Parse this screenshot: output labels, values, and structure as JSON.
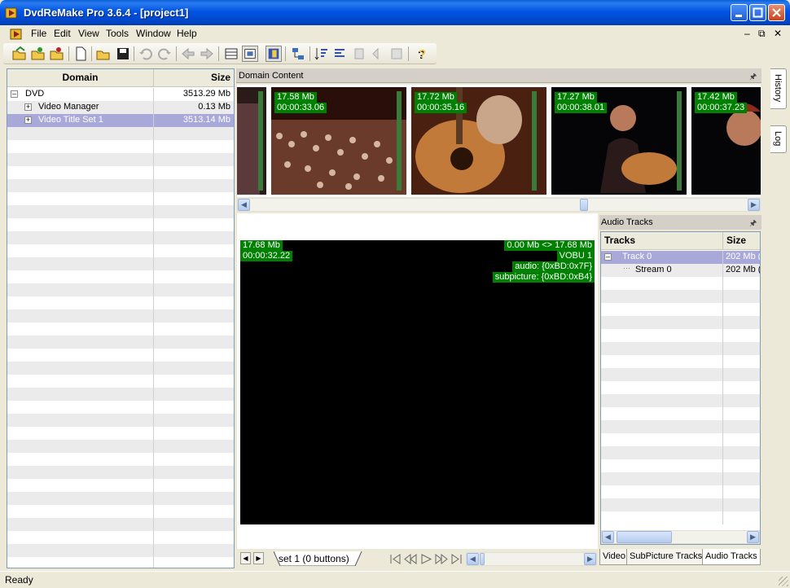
{
  "window": {
    "title": "DvdReMake Pro 3.6.4 - [project1]"
  },
  "menu": {
    "items": [
      "File",
      "Edit",
      "View",
      "Tools",
      "Window",
      "Help"
    ]
  },
  "tree": {
    "columns": [
      "Domain",
      "Size"
    ],
    "rows": [
      {
        "label": "DVD",
        "size": "3513.29 Mb"
      },
      {
        "label": "Video Manager",
        "size": "0.13 Mb"
      },
      {
        "label": "Video Title Set 1",
        "size": "3513.14 Mb"
      }
    ]
  },
  "domain_content": {
    "title": "Domain Content",
    "thumbnails": [
      {
        "size": "",
        "time": ""
      },
      {
        "size": "17.58 Mb",
        "time": "00:00:33.06"
      },
      {
        "size": "17.72 Mb",
        "time": "00:00:35.16"
      },
      {
        "size": "17.27 Mb",
        "time": "00:00:38.01"
      },
      {
        "size": "17.42 Mb",
        "time": "00:00:37.23"
      }
    ]
  },
  "preview": {
    "size": "17.68 Mb",
    "time": "00:00:32.22",
    "range": "0.00 Mb <> 17.68 Mb",
    "vobu": "VOBU 1",
    "audio": "audio: {0xBD:0x7F}",
    "subpicture": "subpicture: {0xBD:0xB4}"
  },
  "audio_tracks": {
    "title": "Audio Tracks",
    "columns": [
      "Tracks",
      "Size"
    ],
    "rows": [
      {
        "label": "Track 0",
        "size": "202 Mb ("
      },
      {
        "label": "Stream 0",
        "size": "202 Mb ("
      }
    ]
  },
  "bottom_tabs": [
    "Video",
    "SubPicture Tracks",
    "Audio Tracks"
  ],
  "set_tab": {
    "label": "set 1 (0 buttons)"
  },
  "side_dock": {
    "tabs": [
      "History",
      "Log"
    ]
  },
  "status": {
    "text": "Ready"
  }
}
